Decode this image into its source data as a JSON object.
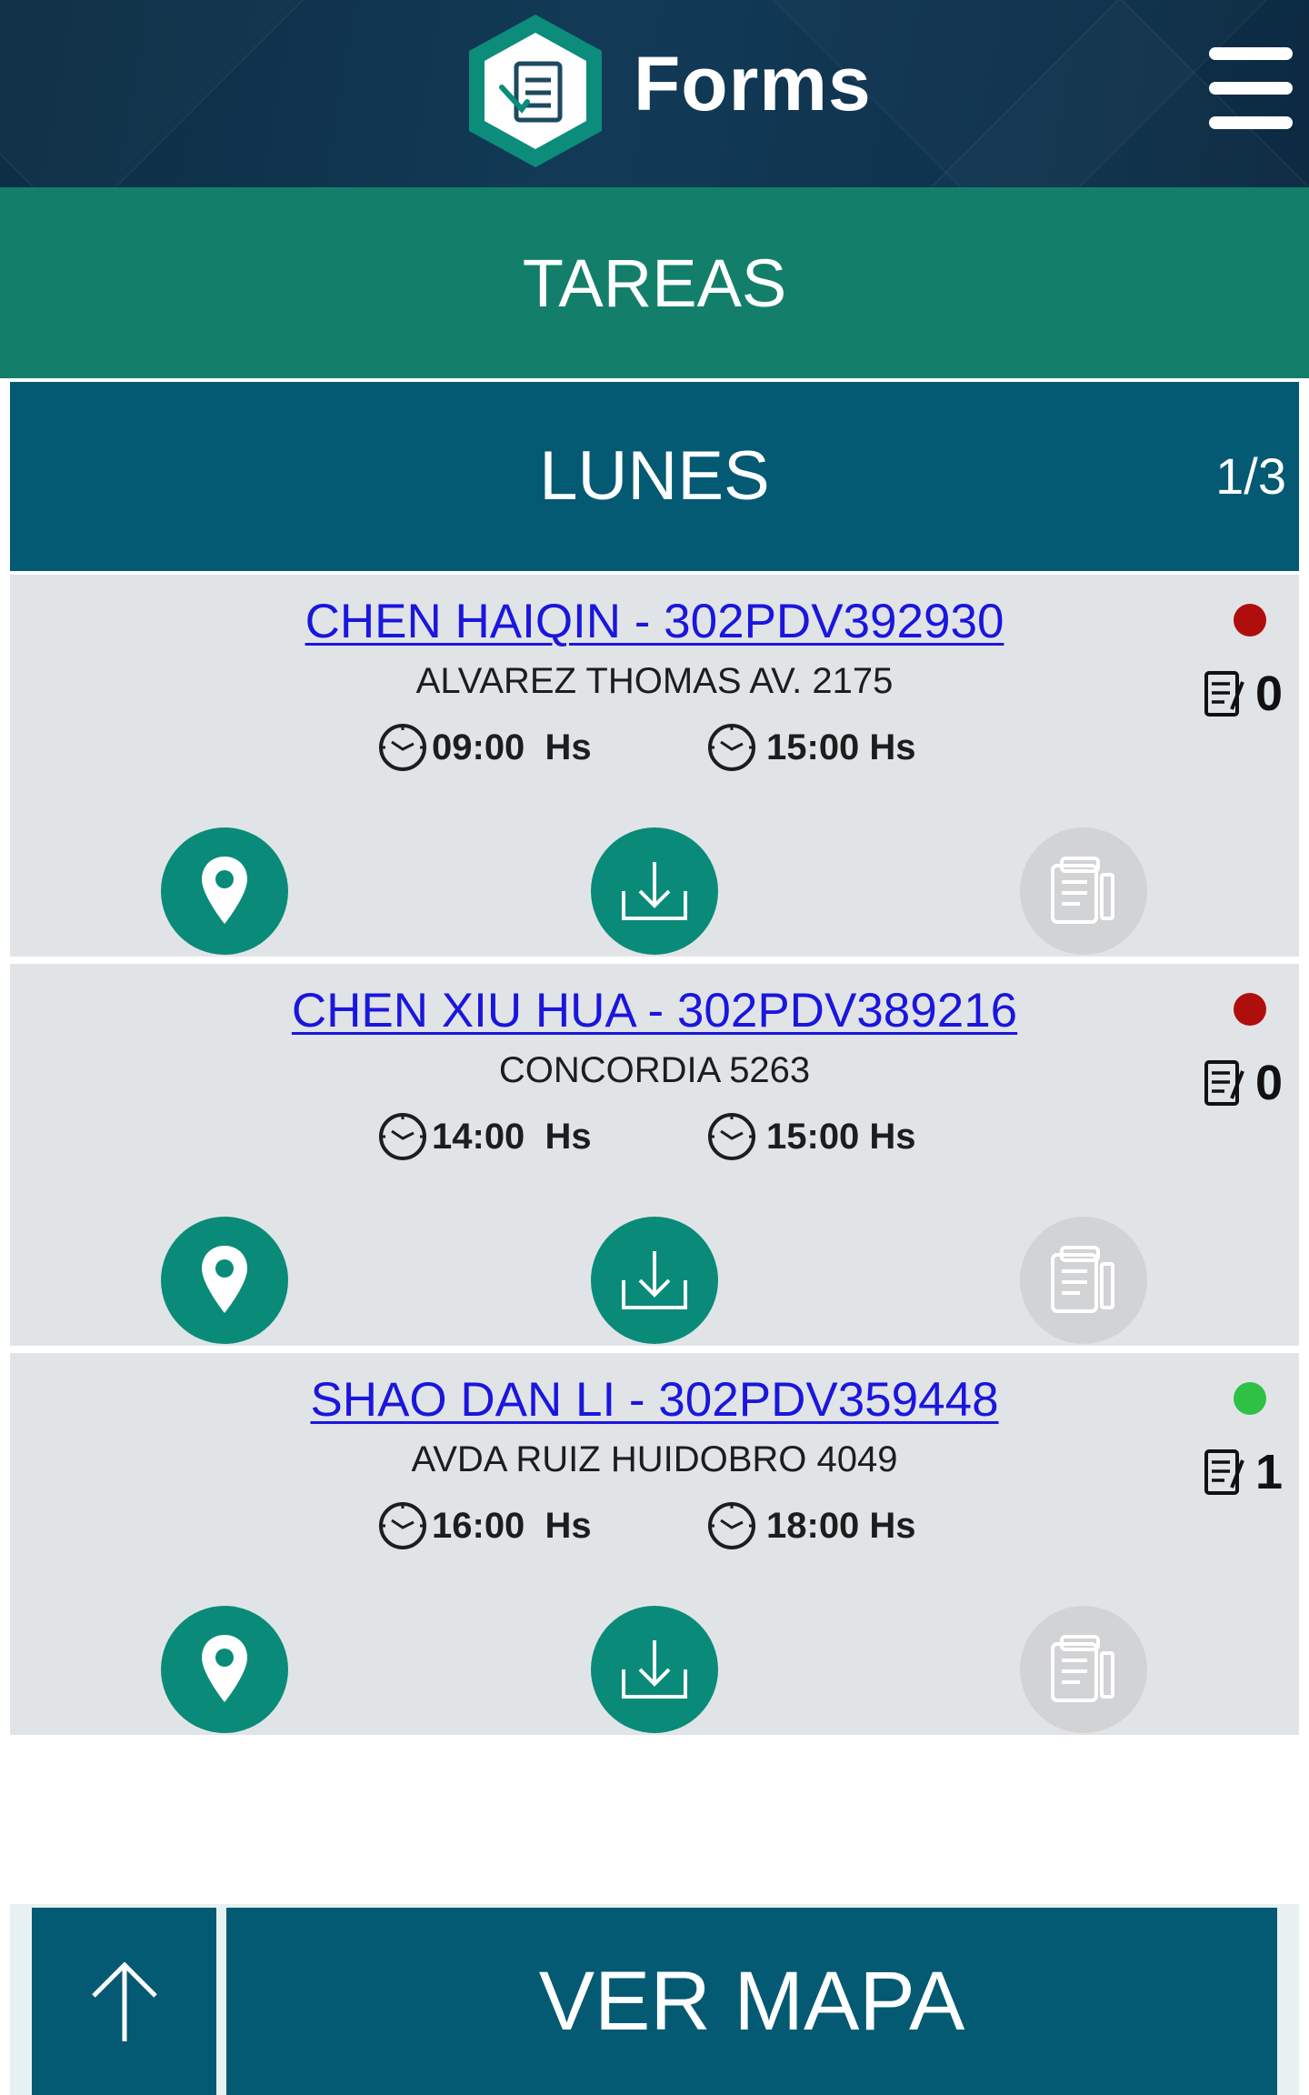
{
  "header": {
    "brand": "Forms",
    "logo_icon": "forms-document-icon",
    "menu_icon": "hamburger-menu-icon"
  },
  "section_title": "TAREAS",
  "day": {
    "title": "LUNES",
    "pager": "1/3"
  },
  "tasks": [
    {
      "title": "CHEN HAIQIN - 302PDV392930",
      "address": "ALVAREZ THOMAS AV. 2175",
      "start_time": "09:00  Hs",
      "end_time": "15:00 Hs",
      "status_color": "#b00d0d",
      "forms_count": "0"
    },
    {
      "title": "CHEN XIU HUA - 302PDV389216",
      "address": "CONCORDIA 5263",
      "start_time": "14:00  Hs",
      "end_time": "15:00 Hs",
      "status_color": "#b00d0d",
      "forms_count": "0"
    },
    {
      "title": "SHAO DAN LI - 302PDV359448",
      "address": "AVDA RUIZ HUIDOBRO 4049",
      "start_time": "16:00  Hs",
      "end_time": "18:00 Hs",
      "status_color": "#2ec146",
      "forms_count": "1"
    }
  ],
  "bottom": {
    "map_button": "VER MAPA",
    "up_icon": "arrow-up-icon"
  },
  "colors": {
    "header_bg": "#123a56",
    "section_bar": "#137f6a",
    "day_bar": "#045a72",
    "card_bg": "#e1e4e7",
    "accent_teal": "#0a8b79",
    "link_blue": "#1a16dd"
  }
}
